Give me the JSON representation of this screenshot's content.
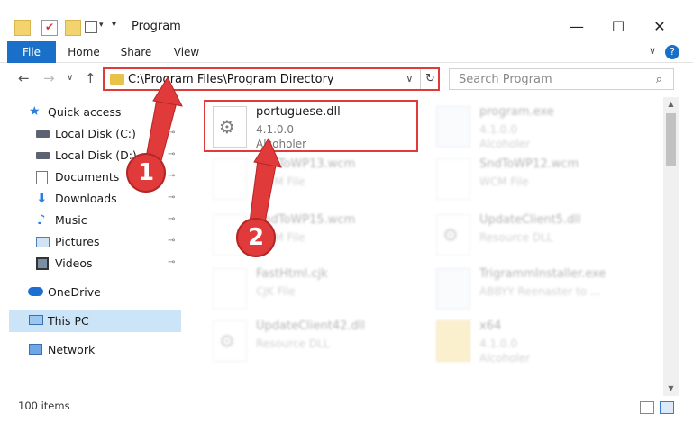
{
  "window": {
    "title": "Program",
    "minimize_glyph": "—",
    "maximize_glyph": "☐",
    "close_glyph": "✕"
  },
  "ribbon": {
    "tabs": [
      "File",
      "Home",
      "Share",
      "View"
    ],
    "collapse_glyph": "∨",
    "help_glyph": "?"
  },
  "nav": {
    "back_glyph": "←",
    "forward_glyph": "→",
    "recent_glyph": "∨",
    "up_glyph": "↑",
    "address_path": "C:\\Program Files\\Program Directory",
    "address_chevron": "∨",
    "refresh_glyph": "↻",
    "search_placeholder": "Search Program",
    "search_glyph": "⌕"
  },
  "sidebar": {
    "items": [
      {
        "label": "Quick access",
        "icon": "star-icon",
        "pinned": false
      },
      {
        "label": "Local Disk (C:)",
        "icon": "drive-icon",
        "pinned": true
      },
      {
        "label": "Local Disk (D:)",
        "icon": "drive-icon",
        "pinned": true
      },
      {
        "label": "Documents",
        "icon": "documents-icon",
        "pinned": true
      },
      {
        "label": "Downloads",
        "icon": "download-icon",
        "pinned": true
      },
      {
        "label": "Music",
        "icon": "music-icon",
        "pinned": true
      },
      {
        "label": "Pictures",
        "icon": "pictures-icon",
        "pinned": true
      },
      {
        "label": "Videos",
        "icon": "videos-icon",
        "pinned": true
      },
      {
        "label": "OneDrive",
        "icon": "cloud-icon",
        "pinned": false
      },
      {
        "label": "This PC",
        "icon": "computer-icon",
        "pinned": false,
        "selected": true
      },
      {
        "label": "Network",
        "icon": "network-icon",
        "pinned": false
      }
    ],
    "pin_glyph": "📌"
  },
  "files": [
    {
      "name": "portuguese.dll",
      "line2": "4.1.0.0",
      "line3": "Alcoholer",
      "icon": "dll-file-icon",
      "highlighted": true
    },
    {
      "name": "program.exe",
      "line2": "4.1.0.0",
      "line3": "Alcoholer",
      "icon": "exe-file-icon"
    },
    {
      "name": "SndToWP13.wcm",
      "line2": "WCM File",
      "line3": "",
      "icon": "blank-file-icon"
    },
    {
      "name": "SndToWP12.wcm",
      "line2": "WCM File",
      "line3": "",
      "icon": "blank-file-icon"
    },
    {
      "name": "SndToWP15.wcm",
      "line2": "WCM File",
      "line3": "",
      "icon": "blank-file-icon"
    },
    {
      "name": "UpdateClient5.dll",
      "line2": "Resource DLL",
      "line3": "",
      "icon": "dll-file-icon"
    },
    {
      "name": "FastHtml.cjk",
      "line2": "CJK File",
      "line3": "",
      "icon": "blank-file-icon"
    },
    {
      "name": "TrigrammInstaller.exe",
      "line2": "ABBYY Reenaster to ...",
      "line3": "",
      "icon": "exe-file-icon"
    },
    {
      "name": "UpdateClient42.dll",
      "line2": "Resource DLL",
      "line3": "",
      "icon": "dll-file-icon"
    },
    {
      "name": "x64",
      "line2": "4.1.0.0",
      "line3": "Alcoholer",
      "icon": "folder-icon"
    }
  ],
  "status": {
    "item_count": "100 items"
  },
  "annotations": {
    "callout_1": "1",
    "callout_2": "2",
    "accent_color": "#e03a3a"
  }
}
